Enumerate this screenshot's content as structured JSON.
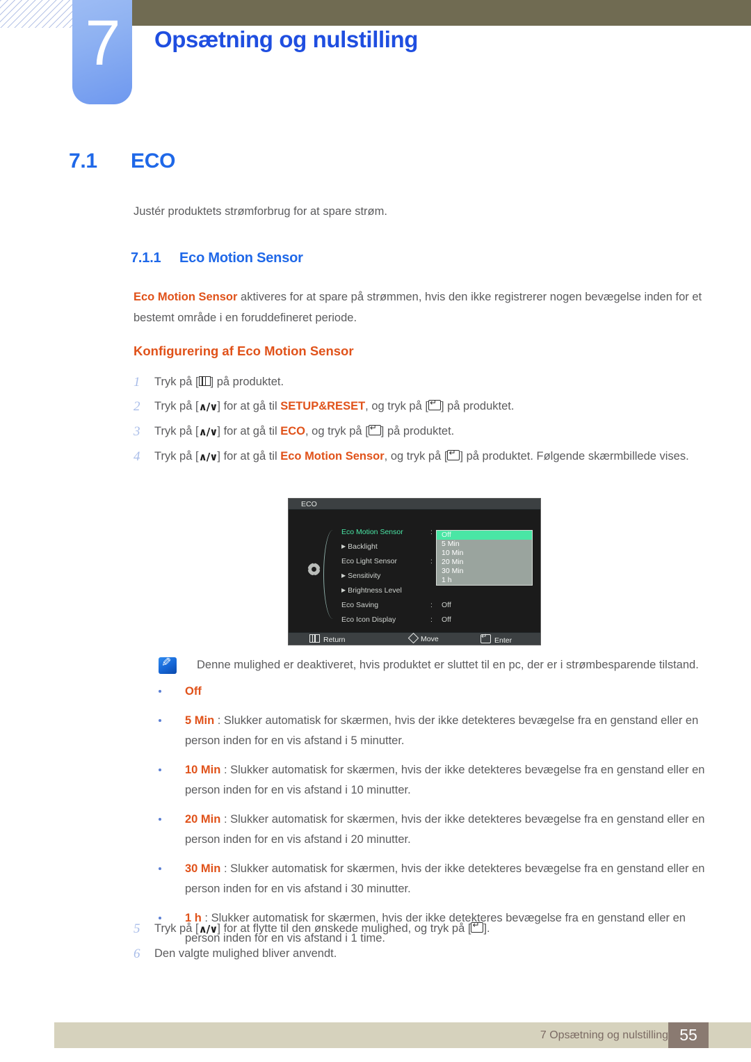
{
  "header": {
    "chapter_number": "7",
    "chapter_title": "Opsætning og nulstilling"
  },
  "section": {
    "number": "7.1",
    "title": "ECO",
    "intro": "Justér produktets strømforbrug for at spare strøm."
  },
  "subsection": {
    "number": "7.1.1",
    "title": "Eco Motion Sensor",
    "paragraph_highlight": "Eco Motion Sensor",
    "paragraph_rest": " aktiveres for at spare på strømmen, hvis den ikke registrerer nogen bevægelse inden for et bestemt område i en foruddefineret periode.",
    "procedure_heading": "Konfigurering af Eco Motion Sensor"
  },
  "steps": [
    {
      "num": "1",
      "parts": [
        {
          "t": "text",
          "v": "Tryk på ["
        },
        {
          "t": "key",
          "v": "menu-key"
        },
        {
          "t": "text",
          "v": "] på produktet."
        }
      ]
    },
    {
      "num": "2",
      "parts": [
        {
          "t": "text",
          "v": "Tryk på ["
        },
        {
          "t": "key",
          "v": "updown-key"
        },
        {
          "t": "text",
          "v": "] for at gå til "
        },
        {
          "t": "orange",
          "v": "SETUP&RESET"
        },
        {
          "t": "text",
          "v": ", og tryk på ["
        },
        {
          "t": "key",
          "v": "enter-key"
        },
        {
          "t": "text",
          "v": "] på produktet."
        }
      ]
    },
    {
      "num": "3",
      "parts": [
        {
          "t": "text",
          "v": "Tryk på ["
        },
        {
          "t": "key",
          "v": "updown-key"
        },
        {
          "t": "text",
          "v": "] for at gå til "
        },
        {
          "t": "orange",
          "v": "ECO"
        },
        {
          "t": "text",
          "v": ", og tryk på ["
        },
        {
          "t": "key",
          "v": "enter-key"
        },
        {
          "t": "text",
          "v": "] på produktet."
        }
      ]
    },
    {
      "num": "4",
      "parts": [
        {
          "t": "text",
          "v": "Tryk på ["
        },
        {
          "t": "key",
          "v": "updown-key"
        },
        {
          "t": "text",
          "v": "] for at gå til "
        },
        {
          "t": "orange",
          "v": "Eco Motion Sensor"
        },
        {
          "t": "text",
          "v": ", og tryk på ["
        },
        {
          "t": "key",
          "v": "enter-key"
        },
        {
          "t": "text",
          "v": "] på produktet. Følgende skærmbillede vises."
        }
      ]
    }
  ],
  "steps_after": [
    {
      "num": "5",
      "parts": [
        {
          "t": "text",
          "v": "Tryk på ["
        },
        {
          "t": "key",
          "v": "updown-key"
        },
        {
          "t": "text",
          "v": "] for at flytte til den ønskede mulighed, og tryk på ["
        },
        {
          "t": "key",
          "v": "enter-key"
        },
        {
          "t": "text",
          "v": "]."
        }
      ]
    },
    {
      "num": "6",
      "parts": [
        {
          "t": "text",
          "v": "Den valgte mulighed bliver anvendt."
        }
      ]
    }
  ],
  "osd": {
    "title": "ECO",
    "rows": [
      {
        "label": "Eco Motion Sensor",
        "colon": ":",
        "value": "",
        "selected": true,
        "sub": false
      },
      {
        "label": "Backlight",
        "colon": "",
        "value": "",
        "selected": false,
        "sub": true
      },
      {
        "label": "Eco Light Sensor",
        "colon": ":",
        "value": "",
        "selected": false,
        "sub": false
      },
      {
        "label": "Sensitivity",
        "colon": "",
        "value": "",
        "selected": false,
        "sub": true
      },
      {
        "label": "Brightness Level",
        "colon": "",
        "value": "",
        "selected": false,
        "sub": true
      },
      {
        "label": "Eco Saving",
        "colon": ":",
        "value": "Off",
        "selected": false,
        "sub": false
      },
      {
        "label": "Eco Icon Display",
        "colon": ":",
        "value": "Off",
        "selected": false,
        "sub": false
      }
    ],
    "dropdown": [
      {
        "label": "Off",
        "selected": true
      },
      {
        "label": "5 Min",
        "selected": false
      },
      {
        "label": "10 Min",
        "selected": false
      },
      {
        "label": "20 Min",
        "selected": false
      },
      {
        "label": "30 Min",
        "selected": false
      },
      {
        "label": "1 h",
        "selected": false
      }
    ],
    "footer": {
      "return_label": "Return",
      "move_label": "Move",
      "enter_label": "Enter"
    },
    "highlight_color": "#4ae6a5",
    "dropdown_bg": "#9aa49e"
  },
  "note": {
    "text": "Denne mulighed er deaktiveret, hvis produktet er sluttet til en pc, der er i strømbesparende tilstand."
  },
  "bullets": [
    {
      "term": "Off",
      "desc": ""
    },
    {
      "term": "5 Min",
      "desc": " : Slukker automatisk for skærmen, hvis der ikke detekteres bevægelse fra en genstand eller en person inden for en vis afstand i 5 minutter."
    },
    {
      "term": "10 Min",
      "desc": " : Slukker automatisk for skærmen, hvis der ikke detekteres bevægelse fra en genstand eller en person inden for en vis afstand i 10 minutter."
    },
    {
      "term": "20 Min",
      "desc": " : Slukker automatisk for skærmen, hvis der ikke detekteres bevægelse fra en genstand eller en person inden for en vis afstand i 20 minutter."
    },
    {
      "term": "30 Min",
      "desc": " : Slukker automatisk for skærmen, hvis der ikke detekteres bevægelse fra en genstand eller en person inden for en vis afstand i 30 minutter."
    },
    {
      "term": "1 h",
      "desc": " : Slukker automatisk for skærmen, hvis der ikke detekteres bevægelse fra en genstand eller en person inden for en vis afstand i 1 time."
    }
  ],
  "footer": {
    "text": "7 Opsætning og nulstilling",
    "page": "55"
  },
  "colors": {
    "heading_blue": "#1f68e8",
    "title_blue": "#1f4ee0",
    "orange": "#e0521a",
    "topbar": "#706b52",
    "footer_band": "#d6d2bd",
    "footer_page_box": "#8a7a71"
  }
}
